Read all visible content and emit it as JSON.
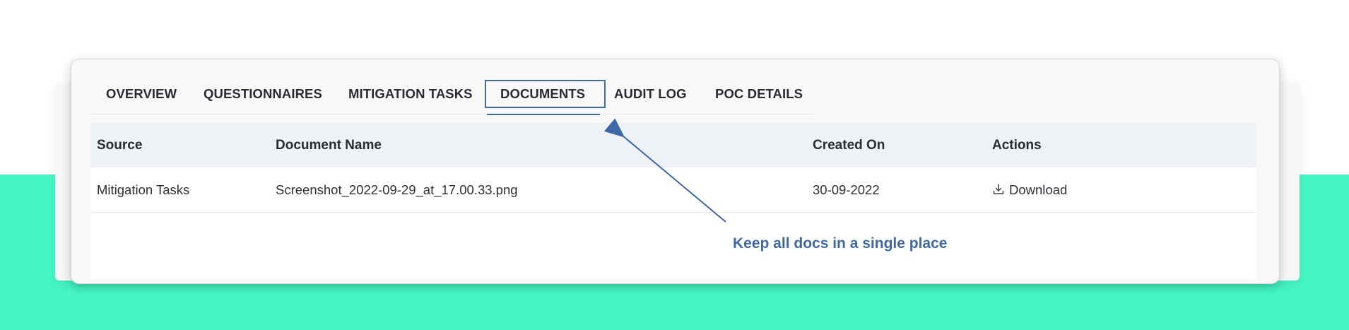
{
  "tabs": [
    {
      "label": "OVERVIEW"
    },
    {
      "label": "QUESTIONNAIRES"
    },
    {
      "label": "MITIGATION TASKS"
    },
    {
      "label": "DOCUMENTS"
    },
    {
      "label": "AUDIT LOG"
    },
    {
      "label": "POC DETAILS"
    }
  ],
  "active_tab": "DOCUMENTS",
  "table": {
    "columns": [
      "Source",
      "Document Name",
      "Created On",
      "Actions"
    ],
    "rows": [
      {
        "source": "Mitigation Tasks",
        "document_name": "Screenshot_2022-09-29_at_17.00.33.png",
        "created_on": "30-09-2022",
        "action_label": "Download",
        "action_icon": "download-icon"
      }
    ]
  },
  "annotation": {
    "text": "Keep all docs in a single place"
  },
  "colors": {
    "accent": "#3f68a8",
    "background_band": "#46f7c6",
    "header_row": "#eef1f6"
  }
}
